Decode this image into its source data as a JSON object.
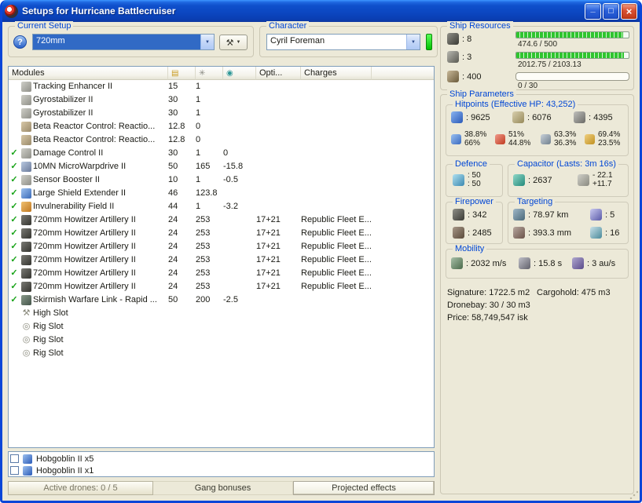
{
  "window": {
    "title": "Setups for Hurricane Battlecruiser"
  },
  "icons": {
    "help": "?",
    "tools": "⚒",
    "dropdown_arrow": "▼",
    "minimize": "_",
    "maximize": "□",
    "close": "×"
  },
  "current_setup": {
    "label": "Current Setup",
    "value": "720mm"
  },
  "character": {
    "label": "Character",
    "value": "Cyril Foreman"
  },
  "ship_resources": {
    "label": "Ship Resources",
    "turret_hardpoints": ": 8",
    "launcher_hardpoints": ": 3",
    "calibration": ": 400",
    "cpu_text": "474.6 / 500",
    "cpu_pct": 95,
    "powergrid_text": "2012.75 / 2103.13",
    "powergrid_pct": 96,
    "dronebay_text": "0 / 30",
    "dronebay_pct": 0
  },
  "modules": {
    "header": {
      "name": "Modules",
      "opti": "Opti...",
      "charges": "Charges"
    },
    "rows": [
      {
        "active": false,
        "icon": "tracking-enhancer-icon",
        "name": "Tracking Enhancer II",
        "cpu": "15",
        "pg": "1",
        "cap": "",
        "opti": "",
        "charge": ""
      },
      {
        "active": false,
        "icon": "gyrostabilizer-icon",
        "name": "Gyrostabilizer II",
        "cpu": "30",
        "pg": "1",
        "cap": "",
        "opti": "",
        "charge": ""
      },
      {
        "active": false,
        "icon": "gyrostabilizer-icon",
        "name": "Gyrostabilizer II",
        "cpu": "30",
        "pg": "1",
        "cap": "",
        "opti": "",
        "charge": ""
      },
      {
        "active": false,
        "icon": "reactor-control-icon",
        "name": "Beta Reactor Control: Reactio...",
        "cpu": "12.8",
        "pg": "0",
        "cap": "",
        "opti": "",
        "charge": ""
      },
      {
        "active": false,
        "icon": "reactor-control-icon",
        "name": "Beta Reactor Control: Reactio...",
        "cpu": "12.8",
        "pg": "0",
        "cap": "",
        "opti": "",
        "charge": ""
      },
      {
        "active": true,
        "icon": "damage-control-icon",
        "name": "Damage Control II",
        "cpu": "30",
        "pg": "1",
        "cap": "0",
        "opti": "",
        "charge": ""
      },
      {
        "active": true,
        "icon": "microwarpdrive-icon",
        "name": "10MN MicroWarpdrive II",
        "cpu": "50",
        "pg": "165",
        "cap": "-15.8",
        "opti": "",
        "charge": ""
      },
      {
        "active": true,
        "icon": "sensor-booster-icon",
        "name": "Sensor Booster II",
        "cpu": "10",
        "pg": "1",
        "cap": "-0.5",
        "opti": "",
        "charge": ""
      },
      {
        "active": true,
        "icon": "shield-extender-icon",
        "name": "Large Shield Extender II",
        "cpu": "46",
        "pg": "123.8",
        "cap": "",
        "opti": "",
        "charge": ""
      },
      {
        "active": true,
        "icon": "invulnerability-field-icon",
        "name": "Invulnerability Field II",
        "cpu": "44",
        "pg": "1",
        "cap": "-3.2",
        "opti": "",
        "charge": ""
      },
      {
        "active": true,
        "icon": "artillery-icon",
        "name": "720mm Howitzer Artillery II",
        "cpu": "24",
        "pg": "253",
        "cap": "",
        "opti": "17+21",
        "charge": "Republic Fleet E..."
      },
      {
        "active": true,
        "icon": "artillery-icon",
        "name": "720mm Howitzer Artillery II",
        "cpu": "24",
        "pg": "253",
        "cap": "",
        "opti": "17+21",
        "charge": "Republic Fleet E..."
      },
      {
        "active": true,
        "icon": "artillery-icon",
        "name": "720mm Howitzer Artillery II",
        "cpu": "24",
        "pg": "253",
        "cap": "",
        "opti": "17+21",
        "charge": "Republic Fleet E..."
      },
      {
        "active": true,
        "icon": "artillery-icon",
        "name": "720mm Howitzer Artillery II",
        "cpu": "24",
        "pg": "253",
        "cap": "",
        "opti": "17+21",
        "charge": "Republic Fleet E..."
      },
      {
        "active": true,
        "icon": "artillery-icon",
        "name": "720mm Howitzer Artillery II",
        "cpu": "24",
        "pg": "253",
        "cap": "",
        "opti": "17+21",
        "charge": "Republic Fleet E..."
      },
      {
        "active": true,
        "icon": "artillery-icon",
        "name": "720mm Howitzer Artillery II",
        "cpu": "24",
        "pg": "253",
        "cap": "",
        "opti": "17+21",
        "charge": "Republic Fleet E..."
      },
      {
        "active": true,
        "icon": "warfare-link-icon",
        "name": "Skirmish Warfare Link - Rapid ...",
        "cpu": "50",
        "pg": "200",
        "cap": "-2.5",
        "opti": "",
        "charge": ""
      },
      {
        "active": false,
        "icon": "high-slot-wrench-icon",
        "name": "High Slot",
        "cpu": "",
        "pg": "",
        "cap": "",
        "opti": "",
        "charge": ""
      },
      {
        "active": false,
        "icon": "rig-slot-icon",
        "name": "Rig Slot",
        "cpu": "",
        "pg": "",
        "cap": "",
        "opti": "",
        "charge": ""
      },
      {
        "active": false,
        "icon": "rig-slot-icon",
        "name": "Rig Slot",
        "cpu": "",
        "pg": "",
        "cap": "",
        "opti": "",
        "charge": ""
      },
      {
        "active": false,
        "icon": "rig-slot-icon",
        "name": "Rig Slot",
        "cpu": "",
        "pg": "",
        "cap": "",
        "opti": "",
        "charge": ""
      }
    ]
  },
  "drones": {
    "items": [
      {
        "name": "Hobgoblin II x5"
      },
      {
        "name": "Hobgoblin II x1"
      }
    ]
  },
  "bottom_bar": {
    "tabs": [
      {
        "label": "Active drones: 0 / 5"
      },
      {
        "label": "Gang bonuses"
      },
      {
        "label": "Projected effects"
      }
    ]
  },
  "ship_parameters": {
    "label": "Ship Parameters",
    "hitpoints": {
      "label": "Hitpoints (Effective HP: 43,252)",
      "shield": ": 9625",
      "armor": ": 6076",
      "structure": ": 4395",
      "resists": [
        {
          "top": "38.8%",
          "bottom": "66%"
        },
        {
          "top": "51%",
          "bottom": "44.8%"
        },
        {
          "top": "63.3%",
          "bottom": "36.3%"
        },
        {
          "top": "69.4%",
          "bottom": "23.5%"
        }
      ]
    },
    "defence": {
      "label": "Defence",
      "value1": ": 50",
      "value2": ": 50"
    },
    "capacitor": {
      "label": "Capacitor (Lasts: 3m 16s)",
      "amount": ": 2637",
      "delta_out": "- 22.1",
      "delta_in": "+11.7"
    },
    "firepower": {
      "label": "Firepower",
      "dps": ": 342",
      "volley": ": 2485"
    },
    "targeting": {
      "label": "Targeting",
      "range": ": 78.97 km",
      "max_targets": ": 5",
      "scan_resolution": ": 393.3 mm",
      "sensor_strength": ": 16"
    },
    "mobility": {
      "label": "Mobility",
      "speed": ": 2032 m/s",
      "align_time": ": 15.8 s",
      "warp_speed": ": 3 au/s"
    },
    "signature": "Signature: 1722.5 m2",
    "cargohold": "Cargohold: 475 m3",
    "dronebay": "Dronebay: 30 / 30 m3",
    "price": "Price: 58,749,547 isk"
  }
}
